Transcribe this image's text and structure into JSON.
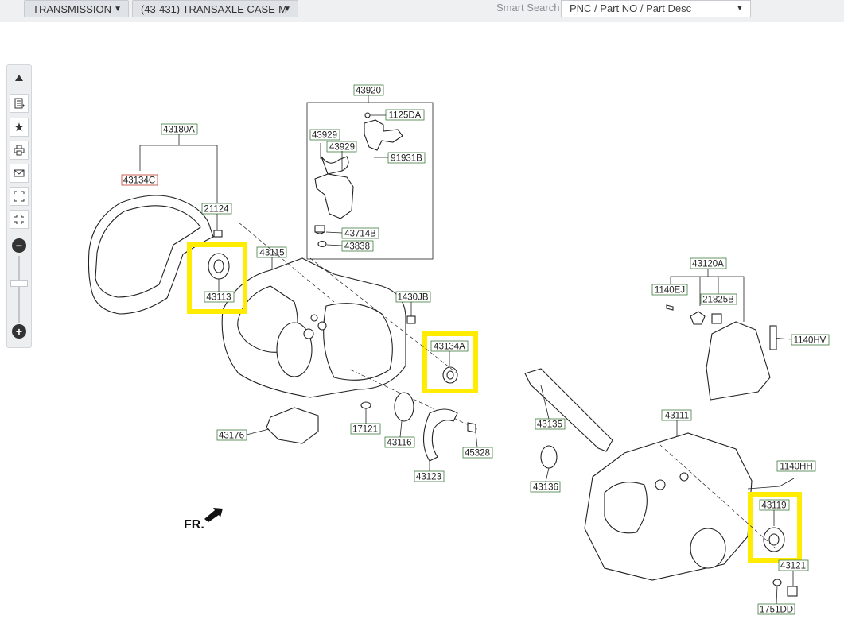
{
  "header": {
    "category_label": "TRANSMISSION",
    "group_label": "(43-431) TRANSAXLE CASE-M",
    "smart_search_label": "Smart Search",
    "smart_search_placeholder": "PNC  /  Part NO  /  Part Desc"
  },
  "toolbar": {
    "buttons": [
      "scroll-up",
      "parts-list",
      "favorite",
      "print",
      "email",
      "expand",
      "collapse"
    ],
    "zoom_out_label": "−",
    "zoom_in_label": "+"
  },
  "diagram": {
    "direction_label": "FR.",
    "labels": {
      "l43920": "43920",
      "l1125DA": "1125DA",
      "l43929a": "43929",
      "l43929b": "43929",
      "l91931B": "91931B",
      "l43714B": "43714B",
      "l43838": "43838",
      "l43180A": "43180A",
      "l43134C": "43134C",
      "l21124": "21124",
      "l43115": "43115",
      "l43113": "43113",
      "l1430JB": "1430JB",
      "l43134A": "43134A",
      "l43176": "43176",
      "l17121": "17121",
      "l43116": "43116",
      "l45328": "45328",
      "l43123": "43123",
      "l43120A": "43120A",
      "l1140EJ": "1140EJ",
      "l21825B": "21825B",
      "l1140HV": "1140HV",
      "l43135": "43135",
      "l43111": "43111",
      "l43136": "43136",
      "l1140HH": "1140HH",
      "l43119": "43119",
      "l43121": "43121",
      "l1751DD": "1751DD"
    },
    "highlight_color": "#ffec00"
  }
}
